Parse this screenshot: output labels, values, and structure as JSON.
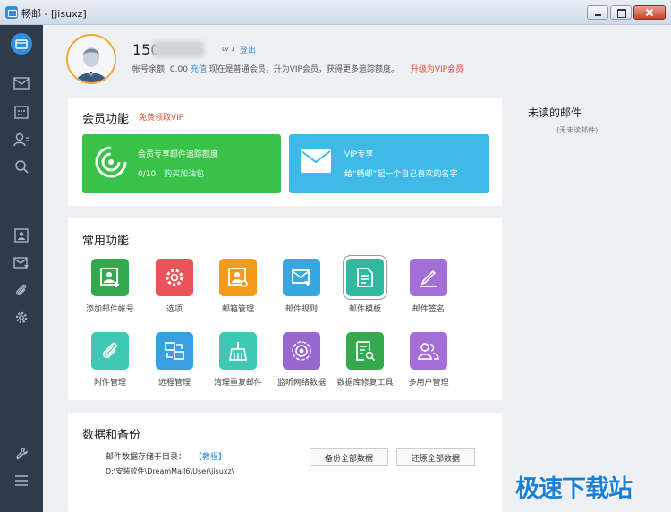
{
  "window": {
    "title": "畅邮 - [jisuxz]"
  },
  "profile": {
    "username": "150",
    "level": "LV 1",
    "logout": "登出",
    "balance_label": "帐号余额:",
    "balance_value": "0.00",
    "charge": "充值",
    "notice": "现在是普通会员，升为VIP会员，获得更多追踪额度。",
    "upgrade": "升级为VIP会员"
  },
  "vip": {
    "title": "会员功能",
    "free_vip": "免费领取VIP",
    "tile1_title": "会员专享邮件追踪额度",
    "tile1_count": "0/10",
    "tile1_link": "购买加油包",
    "tile2_title": "VIP专享",
    "tile2_desc": "给“畅邮”起一个自己喜欢的名字"
  },
  "functions": {
    "title": "常用功能",
    "items": [
      {
        "label": "添加邮件帐号",
        "color": "#35a94e",
        "icon": "add-account-icon"
      },
      {
        "label": "选项",
        "color": "#e9545a",
        "icon": "gear-icon"
      },
      {
        "label": "邮箱管理",
        "color": "#f39a1b",
        "icon": "mailbox-manage-icon"
      },
      {
        "label": "邮件规则",
        "color": "#36a8e0",
        "icon": "mail-rule-icon"
      },
      {
        "label": "邮件模板",
        "color": "#2fb99f",
        "icon": "template-icon"
      },
      {
        "label": "邮件签名",
        "color": "#a46ed8",
        "icon": "signature-icon"
      },
      {
        "label": "附件管理",
        "color": "#3fc9b5",
        "icon": "attachment-icon"
      },
      {
        "label": "远程管理",
        "color": "#3a9ee3",
        "icon": "remote-icon"
      },
      {
        "label": "清理重复邮件",
        "color": "#3fc9b5",
        "icon": "broom-icon"
      },
      {
        "label": "监听网络数据",
        "color": "#9a67d0",
        "icon": "monitor-icon"
      },
      {
        "label": "数据库修复工具",
        "color": "#35a94e",
        "icon": "db-repair-icon"
      },
      {
        "label": "多用户管理",
        "color": "#a46ed8",
        "icon": "multi-user-icon"
      }
    ]
  },
  "backup": {
    "title": "数据和备份",
    "storage_label": "邮件数据存储于目录：",
    "tutorial": "【教程】",
    "path": "D:\\安装软件\\DreamMail6\\User\\jisuxz\\",
    "backup_all": "备份全部数据",
    "restore_all": "还原全部数据"
  },
  "unread": {
    "title": "未读的邮件",
    "empty": "(无未读邮件)"
  },
  "watermark": "极速下载站"
}
